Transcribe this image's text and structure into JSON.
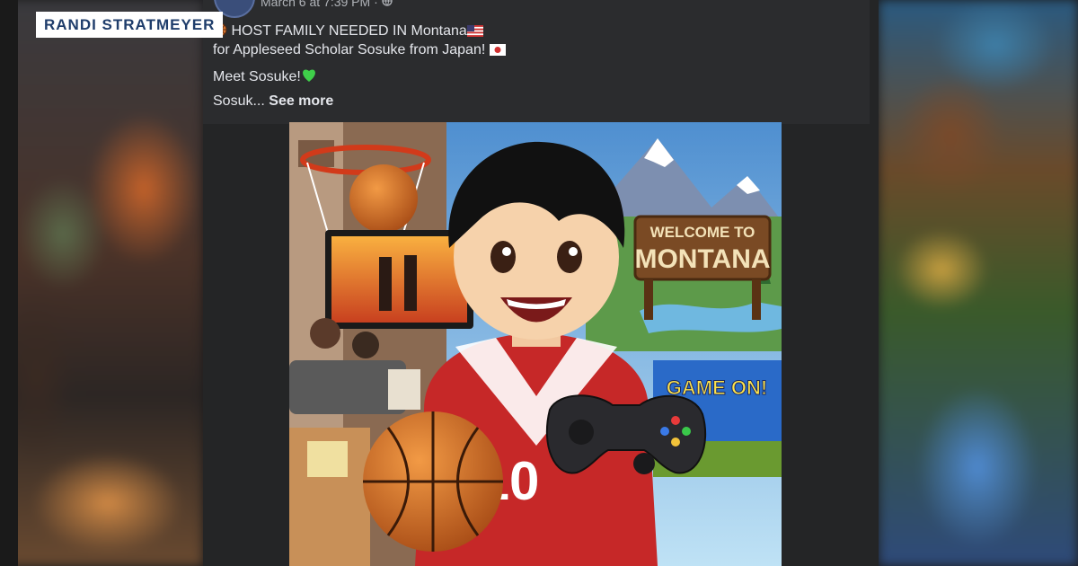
{
  "nameplate": "RANDI STRATMEYER",
  "post": {
    "timestamp": "March 6 at 7:39 PM",
    "line1_text": "HOST FAMILY NEEDED IN Montana",
    "line2_text": "for Appleseed Scholar Sosuke from Japan!",
    "line3_text": "Meet Sosuke!",
    "line4_text": "Sosuk...",
    "see_more": "See more"
  },
  "image": {
    "sign_top": "WELCOME TO",
    "sign_main": "MONTANA",
    "game_banner": "GAME ON!",
    "jersey_number": "10"
  },
  "icons": [
    "basketball-icon",
    "us-flag-icon",
    "japan-flag-icon",
    "green-heart-icon",
    "globe-icon"
  ],
  "colors": {
    "post_bg": "#242526",
    "text": "#e4e6eb",
    "meta": "#b0b3b8",
    "nameplate_text": "#1f3d6b"
  }
}
